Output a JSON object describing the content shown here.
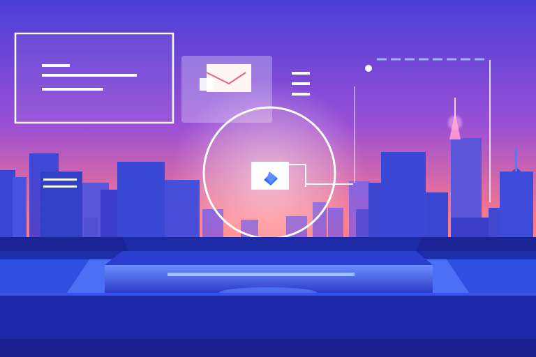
{
  "scene": {
    "palette": {
      "sky_top": "#4a3fd6",
      "sky_mid": "#b54fd0",
      "sky_low": "#ff7a86",
      "building_blue": "#3b3fd0",
      "building_violet": "#6a4fd8",
      "panel_glow": "#ffffff",
      "desk_dark": "#1f2aa6",
      "desk_light": "#3a5bf0",
      "accent_blue": "#2f6bff"
    },
    "icons": [
      "email-envelope-icon",
      "hamburger-menu-icon",
      "chat-bubble-icon",
      "widget-text-lines-icon"
    ],
    "overlays": [
      "left-outline-window",
      "email-card",
      "menu-lines",
      "right-window-frame",
      "circle-ring",
      "center-chat-card",
      "small-lines-card"
    ]
  }
}
